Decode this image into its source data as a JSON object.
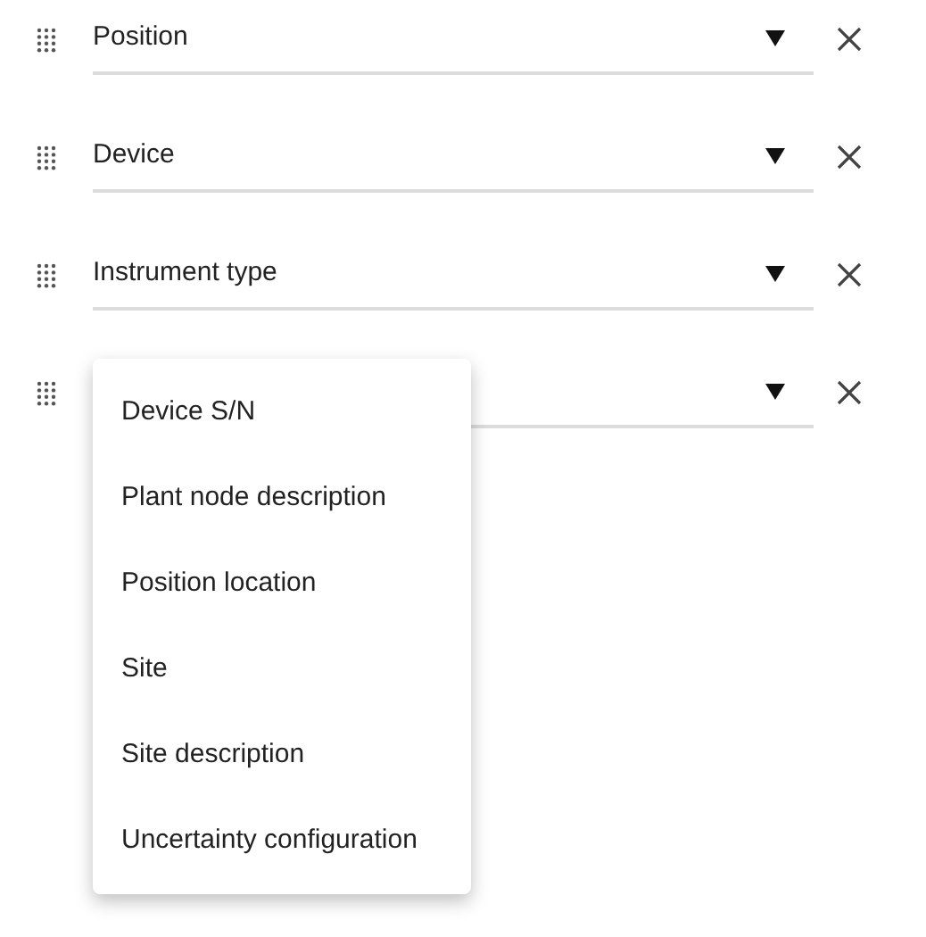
{
  "rows": [
    {
      "value": "Position"
    },
    {
      "value": "Device"
    },
    {
      "value": "Instrument type"
    },
    {}
  ],
  "menu": {
    "open": true,
    "items": [
      "Device S/N",
      "Plant node description",
      "Position location",
      "Site",
      "Site description",
      "Uncertainty configuration"
    ]
  }
}
